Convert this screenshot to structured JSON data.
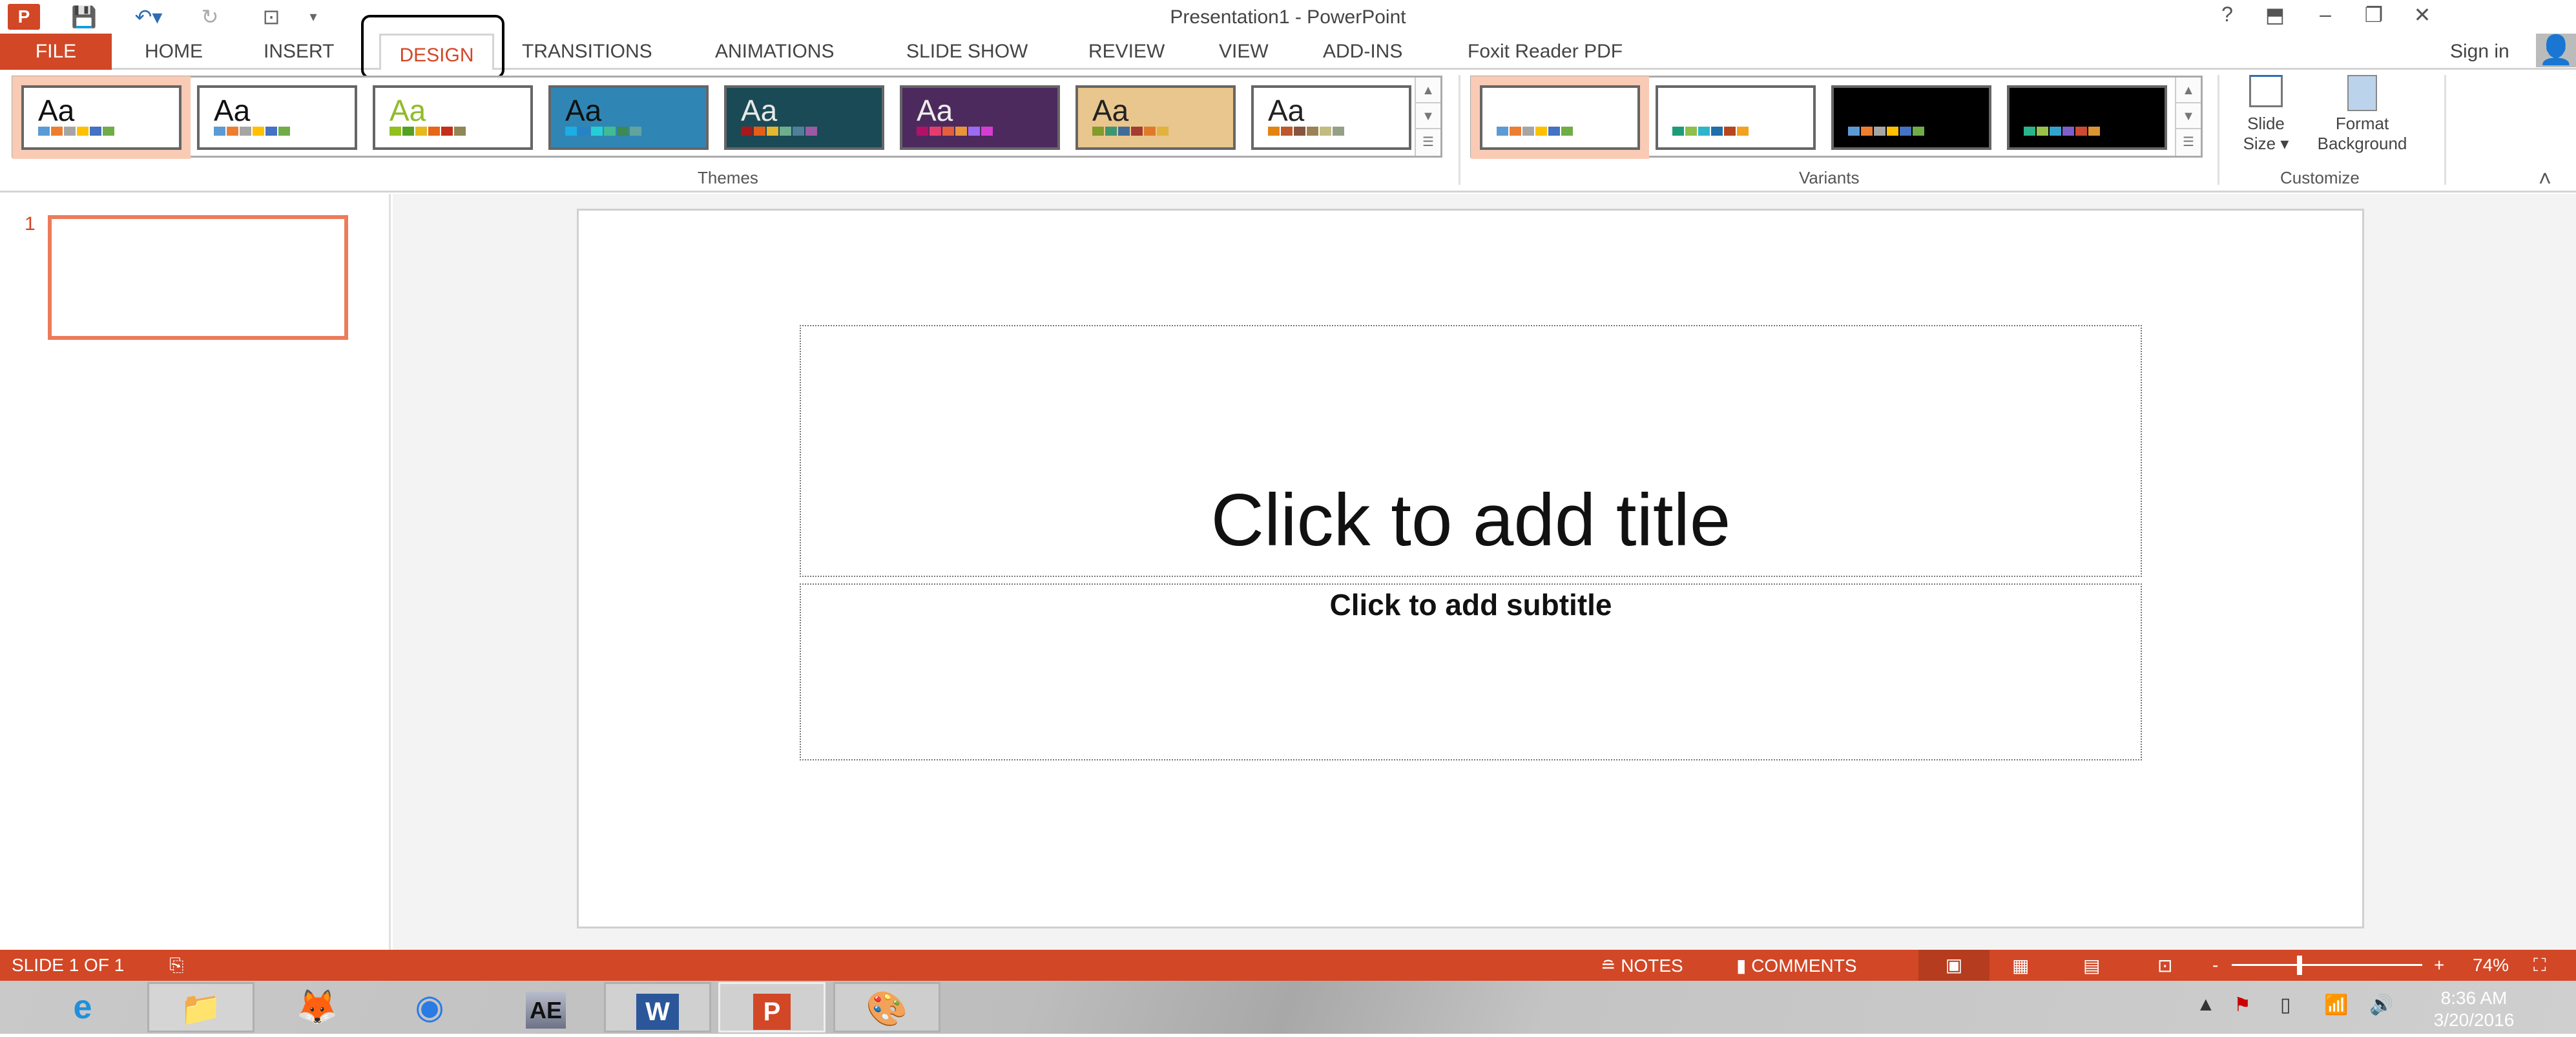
{
  "window": {
    "title": "Presentation1 - PowerPoint",
    "help": "?",
    "ribbon_display": "⬒",
    "minimize": "–",
    "restore": "❐",
    "close": "✕"
  },
  "quick_access": {
    "app_icon": "P",
    "save": "💾",
    "undo": "↶▾",
    "redo": "↻",
    "present": "⊡",
    "customize": "▾"
  },
  "tabs": {
    "file": "FILE",
    "items": [
      "HOME",
      "INSERT",
      "DESIGN",
      "TRANSITIONS",
      "ANIMATIONS",
      "SLIDE SHOW",
      "REVIEW",
      "VIEW",
      "ADD-INS",
      "Foxit Reader PDF"
    ],
    "active": "DESIGN",
    "sign_in": "Sign in"
  },
  "ribbon": {
    "themes_label": "Themes",
    "themes": [
      {
        "aa": "Aa",
        "bg": "#ffffff",
        "fg": "#111111",
        "swatches": [
          "#5b9bd5",
          "#ed7d31",
          "#a5a5a5",
          "#ffc000",
          "#4472c4",
          "#70ad47"
        ],
        "selected": true
      },
      {
        "aa": "Aa",
        "bg": "#ffffff",
        "fg": "#111111",
        "swatches": [
          "#5b9bd5",
          "#ed7d31",
          "#a5a5a5",
          "#ffc000",
          "#4472c4",
          "#70ad47"
        ]
      },
      {
        "aa": "Aa",
        "bg": "#ffffff",
        "fg": "#8fbc2a",
        "swatches": [
          "#92c01f",
          "#54a021",
          "#e6b91e",
          "#e76618",
          "#c42f1a",
          "#918655"
        ]
      },
      {
        "aa": "Aa",
        "bg": "#2f86b5",
        "fg": "#111111",
        "swatches": [
          "#1cade4",
          "#2683c6",
          "#27ced7",
          "#42ba97",
          "#3e8853",
          "#62a39f"
        ]
      },
      {
        "aa": "Aa",
        "bg": "#1a4a55",
        "fg": "#e8e8e8",
        "swatches": [
          "#a5191b",
          "#e25e19",
          "#e3b730",
          "#6eae8e",
          "#4f7f99",
          "#9a5aa4"
        ]
      },
      {
        "aa": "Aa",
        "bg": "#4d2a5e",
        "fg": "#eeeeee",
        "swatches": [
          "#b31166",
          "#e33d6f",
          "#e45f3c",
          "#e9943a",
          "#9b6bf2",
          "#d53dd0"
        ]
      },
      {
        "aa": "Aa",
        "bg": "#e9c68d",
        "fg": "#222222",
        "swatches": [
          "#839b2b",
          "#3c9770",
          "#416c98",
          "#a33d32",
          "#e07a2b",
          "#e1b33d"
        ]
      },
      {
        "aa": "Aa",
        "bg": "#ffffff",
        "fg": "#222222",
        "swatches": [
          "#e48312",
          "#bd582c",
          "#865640",
          "#9b8357",
          "#c2bc80",
          "#94a088"
        ]
      }
    ],
    "variants_label": "Variants",
    "variants": [
      {
        "bg": "#ffffff",
        "swatches": [
          "#5b9bd5",
          "#ed7d31",
          "#a5a5a5",
          "#ffc000",
          "#4472c4",
          "#70ad47"
        ],
        "selected": true
      },
      {
        "bg": "#ffffff",
        "swatches": [
          "#1e9c7a",
          "#8cc04a",
          "#2fb5cb",
          "#1f6fa8",
          "#b7461e",
          "#f1a21f"
        ]
      },
      {
        "bg": "#000000",
        "swatches": [
          "#5b9bd5",
          "#ed7d31",
          "#a5a5a5",
          "#ffc000",
          "#4472c4",
          "#70ad47"
        ]
      },
      {
        "bg": "#000000",
        "swatches": [
          "#2ab38c",
          "#98c14b",
          "#34a2cf",
          "#7e5fc7",
          "#cc4a31",
          "#dc9434"
        ]
      }
    ],
    "customize_label": "Customize",
    "slide_size": "Slide",
    "slide_size_2": "Size ▾",
    "format_bg": "Format",
    "format_bg_2": "Background",
    "collapse": "˄"
  },
  "slides": {
    "number": "1"
  },
  "slide": {
    "title_placeholder": "Click to add title",
    "subtitle_placeholder": "Click to add subtitle"
  },
  "status": {
    "slide_count": "SLIDE 1 OF 1",
    "notes": "NOTES",
    "comments": "COMMENTS",
    "zoom": "74%",
    "zoom_minus": "-",
    "zoom_plus": "+",
    "zoom_level_percent": 74
  },
  "taskbar": {
    "apps": [
      "e",
      "📁",
      "🦊",
      "◉",
      "AE",
      "W",
      "P",
      "🎨"
    ],
    "time": "8:36 AM",
    "date": "3/20/2016"
  },
  "colors": {
    "accent": "#d24726",
    "selection": "#f9cbb5"
  }
}
